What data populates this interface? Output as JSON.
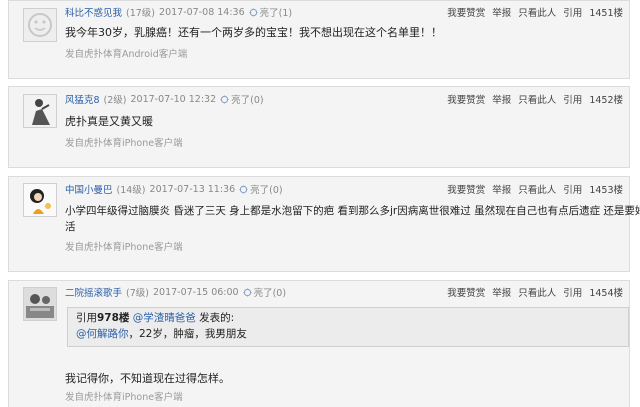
{
  "actions": {
    "like": "我要赞赏",
    "report": "举报",
    "only_this": "只看此人",
    "quote": "引用"
  },
  "posts": [
    {
      "username": "科比不惑见我",
      "level": "(17级)",
      "date": "2017-07-08 14:36",
      "light": "亮了(1)",
      "floor": "1451楼",
      "content": "我今年30岁，乳腺癌！还有一个两岁多的宝宝！我不想出现在这个名单里！！",
      "device": "发自虎扑体育Android客户端"
    },
    {
      "username": "风猛克8",
      "level": "(2级)",
      "date": "2017-07-10 12:32",
      "light": "亮了(0)",
      "floor": "1452楼",
      "content": "虎扑真是又黄又暖",
      "device": "发自虎扑体育iPhone客户端"
    },
    {
      "username": "中国小曼巴",
      "level": "(14级)",
      "date": "2017-07-13 11:36",
      "light": "亮了(0)",
      "floor": "1453楼",
      "content_line1": "小学四年级得过脑膜炎 昏迷了三天 身上都是水泡留下的疤 看到那么多jr因病离世很难过 虽然现在自己也有点后遗症 还是要好好生",
      "content_line2": "活",
      "device": "发自虎扑体育iPhone客户端"
    },
    {
      "username": "二院摇滚歌手",
      "level": "(7级)",
      "date": "2017-07-15 06:00",
      "light": "亮了(0)",
      "floor": "1454楼",
      "quote": {
        "prefix": "引用",
        "floor": "978楼",
        "at_user": "@学渣晴爸爸",
        "said": "发表的:",
        "mention": "@何解路你",
        "text": "，22岁，肿瘤，我男朋友"
      },
      "content": "我记得你，不知道现在过得怎样。",
      "device": "发自虎扑体育iPhone客户端"
    }
  ]
}
